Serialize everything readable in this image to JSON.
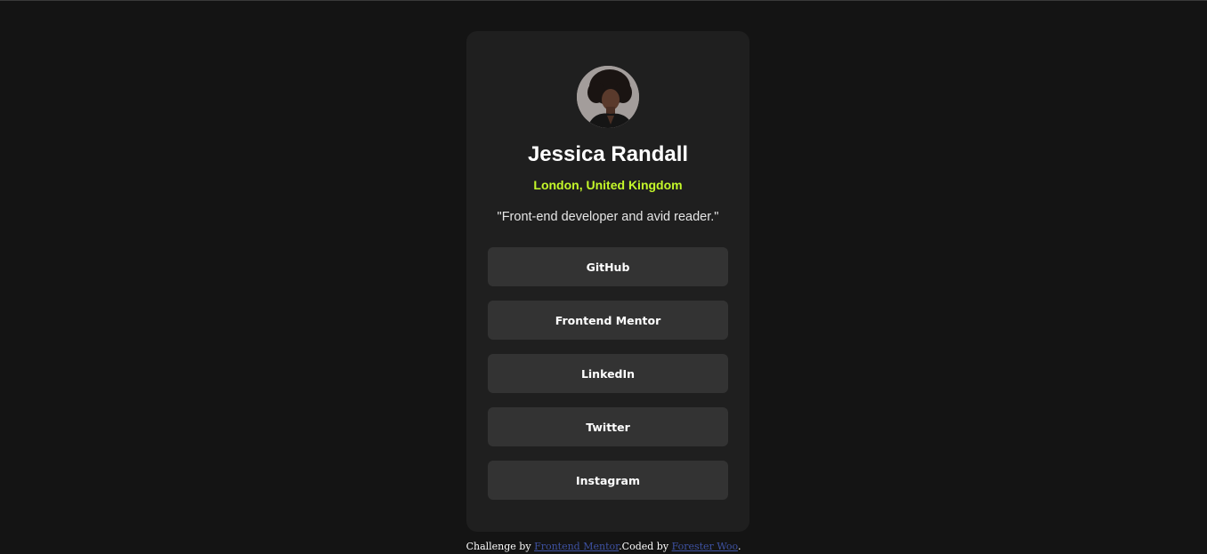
{
  "profile": {
    "name": "Jessica Randall",
    "location": "London, United Kingdom",
    "bio": "\"Front-end developer and avid reader.\""
  },
  "links": [
    {
      "label": "GitHub"
    },
    {
      "label": "Frontend Mentor"
    },
    {
      "label": "LinkedIn"
    },
    {
      "label": "Twitter"
    },
    {
      "label": "Instagram"
    }
  ],
  "footer": {
    "prefix": "Challenge by ",
    "challenge_link": "Frontend Mentor",
    "middle": ".Coded by ",
    "author_link": "Forester Woo",
    "suffix": "."
  },
  "colors": {
    "background": "#141414",
    "card": "#1f1f1f",
    "button": "#333333",
    "accent": "#c4f82a",
    "footer_link": "#3e52a3"
  }
}
